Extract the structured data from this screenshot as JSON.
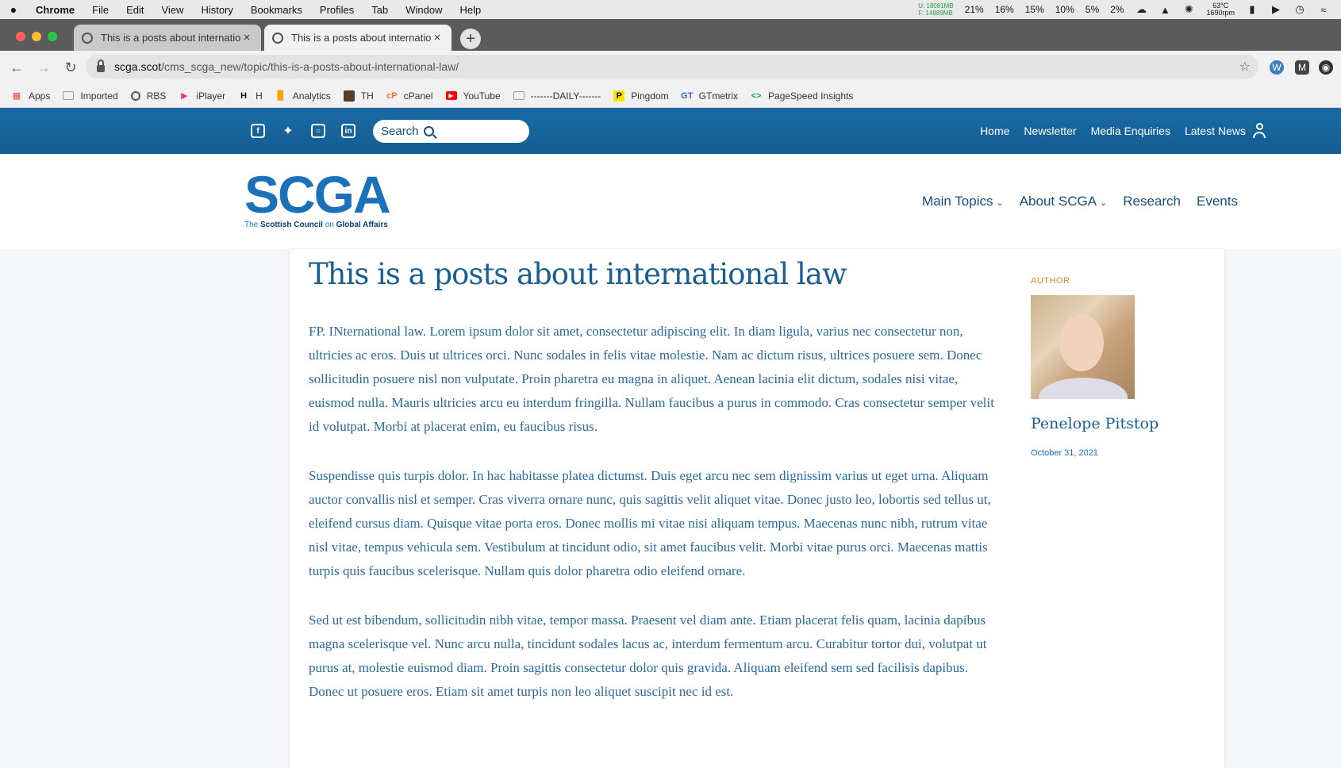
{
  "menubar": {
    "app": "Chrome",
    "items": [
      "File",
      "Edit",
      "View",
      "History",
      "Bookmarks",
      "Profiles",
      "Tab",
      "Window",
      "Help"
    ],
    "mem_used": "U: 18081MB",
    "mem_free": "F: 14889MB",
    "cpu": [
      "21%",
      "16%",
      "15%",
      "10%",
      "5%",
      "2%"
    ],
    "temp": "63°C",
    "fan": "1690rpm"
  },
  "tabs": [
    {
      "title": "This is a posts about internatio"
    },
    {
      "title": "This is a posts about internatio"
    }
  ],
  "address": {
    "host": "scga.scot",
    "path": "/cms_scga_new/topic/this-is-a-posts-about-international-law/"
  },
  "bookmarks": [
    "Apps",
    "Imported",
    "RBS",
    "iPlayer",
    "H",
    "Analytics",
    "TH",
    "cPanel",
    "YouTube",
    "-------DAILY-------",
    "Pingdom",
    "GTmetrix",
    "PageSpeed Insights"
  ],
  "site": {
    "search_placeholder": "Search",
    "topnav": [
      "Home",
      "Newsletter",
      "Media Enquiries",
      "Latest News"
    ],
    "logo_text": "SCGA",
    "logo_tag_pre": "The ",
    "logo_tag_mid": "Scottish Council",
    "logo_tag_on": " on ",
    "logo_tag_end": "Global Affairs",
    "mainnav": [
      "Main Topics",
      "About SCGA",
      "Research",
      "Events"
    ]
  },
  "article": {
    "title": "This is a posts about international law",
    "paragraphs": [
      "FP. INternational law. Lorem ipsum dolor sit amet, consectetur adipiscing elit. In diam ligula, varius nec consectetur non, ultricies ac eros. Duis ut ultrices orci. Nunc sodales in felis vitae molestie. Nam ac dictum risus, ultrices posuere sem. Donec sollicitudin posuere nisl non vulputate. Proin pharetra eu magna in aliquet. Aenean lacinia elit dictum, sodales nisi vitae, euismod nulla. Mauris ultricies arcu eu interdum fringilla. Nullam faucibus a purus in commodo. Cras consectetur semper velit id volutpat. Morbi at placerat enim, eu faucibus risus.",
      "Suspendisse quis turpis dolor. In hac habitasse platea dictumst. Duis eget arcu nec sem dignissim varius ut eget urna. Aliquam auctor convallis nisl et semper. Cras viverra ornare nunc, quis sagittis velit aliquet vitae. Donec justo leo, lobortis sed tellus ut, eleifend cursus diam. Quisque vitae porta eros. Donec mollis mi vitae nisi aliquam tempus. Maecenas nunc nibh, rutrum vitae nisl vitae, tempus vehicula sem. Vestibulum at tincidunt odio, sit amet faucibus velit. Morbi vitae purus orci. Maecenas mattis turpis quis faucibus scelerisque. Nullam quis dolor pharetra odio eleifend ornare.",
      "Sed ut est bibendum, sollicitudin nibh vitae, tempor massa. Praesent vel diam ante. Etiam placerat felis quam, lacinia dapibus magna scelerisque vel. Nunc arcu nulla, tincidunt sodales lacus ac, interdum fermentum arcu. Curabitur tortor dui, volutpat ut purus at, molestie euismod diam. Proin sagittis consectetur dolor quis gravida. Aliquam eleifend sem sed facilisis dapibus. Donec ut posuere eros. Etiam sit amet turpis non leo aliquet suscipit nec id est."
    ]
  },
  "sidebar": {
    "label": "AUTHOR",
    "author": "Penelope Pitstop",
    "date": "October 31, 2021"
  },
  "colors": {
    "brand_blue": "#1a71b8",
    "bar_blue": "#135e93",
    "accent_orange": "#d98a1e"
  }
}
